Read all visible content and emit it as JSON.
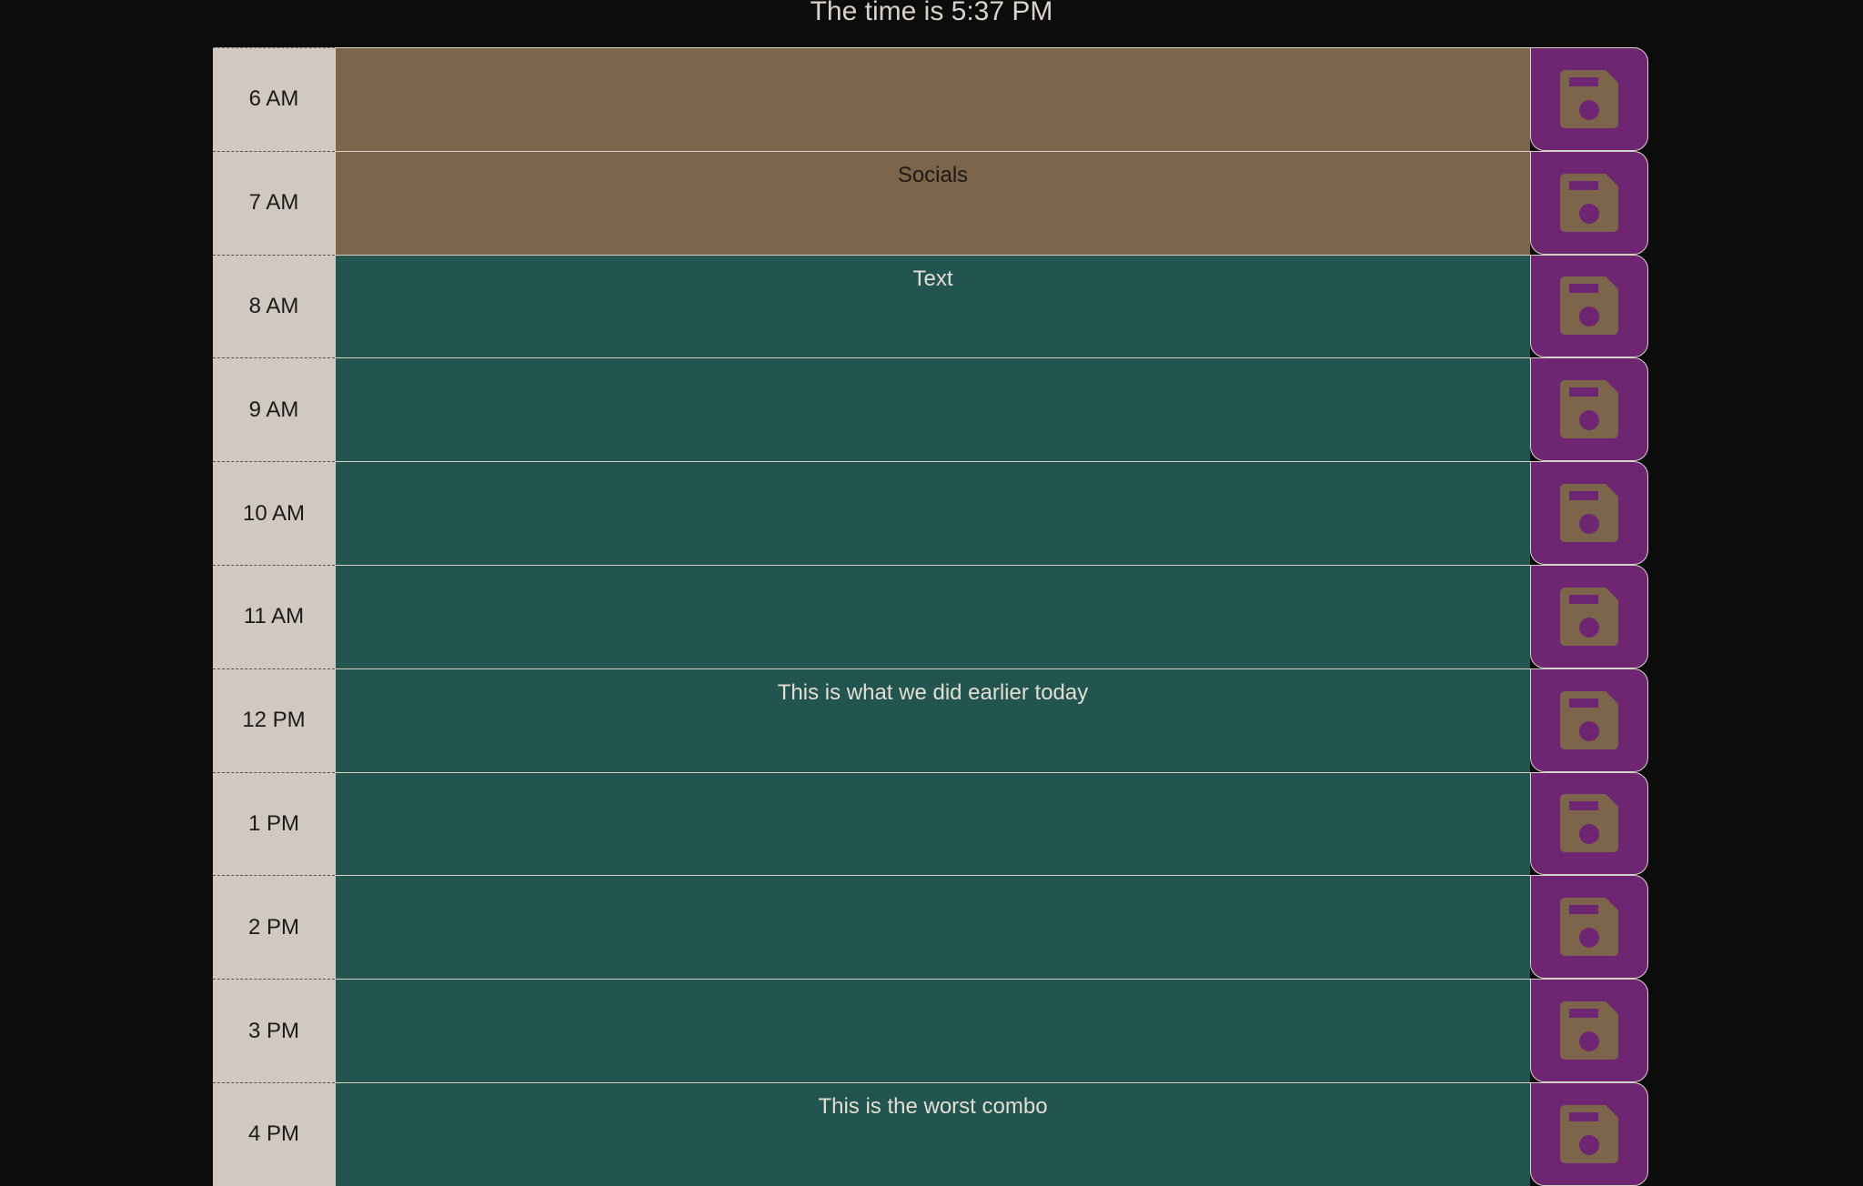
{
  "header": {
    "prefix": "The time is ",
    "time": "5:37 PM"
  },
  "colors": {
    "background": "#0c0c0c",
    "hour_column": "#d1c8c0",
    "past": "#7c654a",
    "future": "#225450",
    "save_button": "#6e2672",
    "save_icon": "#7c654a"
  },
  "rows": [
    {
      "hour": "6 AM",
      "text": "",
      "state": "past"
    },
    {
      "hour": "7 AM",
      "text": "Socials",
      "state": "past"
    },
    {
      "hour": "8 AM",
      "text": "Text",
      "state": "future"
    },
    {
      "hour": "9 AM",
      "text": "",
      "state": "future"
    },
    {
      "hour": "10 AM",
      "text": "",
      "state": "future"
    },
    {
      "hour": "11 AM",
      "text": "",
      "state": "future"
    },
    {
      "hour": "12 PM",
      "text": "This is what we did earlier today",
      "state": "future"
    },
    {
      "hour": "1 PM",
      "text": "",
      "state": "future"
    },
    {
      "hour": "2 PM",
      "text": "",
      "state": "future"
    },
    {
      "hour": "3 PM",
      "text": "",
      "state": "future"
    },
    {
      "hour": "4 PM",
      "text": "This is the worst combo",
      "state": "future"
    }
  ]
}
